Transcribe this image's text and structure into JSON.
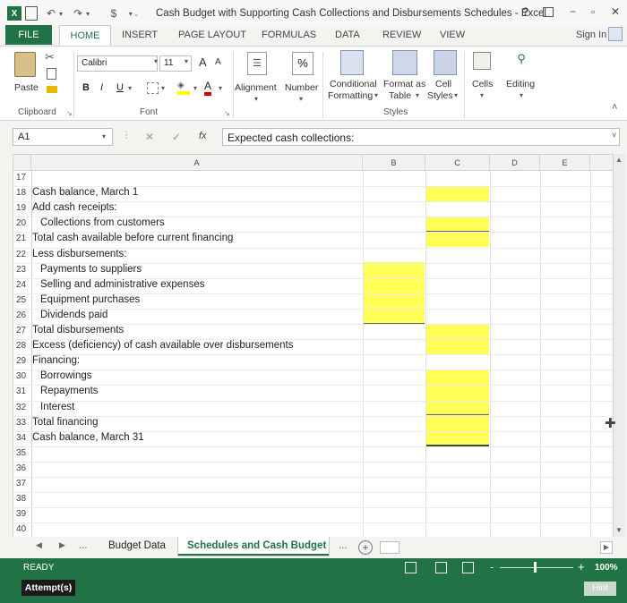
{
  "app": {
    "title": "Cash Budget with Supporting Cash Collections and Disbursements Schedules - Excel",
    "help": "?",
    "sign_in": "Sign In"
  },
  "ribbon_tabs": [
    "FILE",
    "HOME",
    "INSERT",
    "PAGE LAYOUT",
    "FORMULAS",
    "DATA",
    "REVIEW",
    "VIEW"
  ],
  "ribbon": {
    "paste": "Paste",
    "clipboard": "Clipboard",
    "font_name": "Calibri",
    "font_size": "11",
    "grow_font": "A",
    "shrink_font": "A",
    "bold": "B",
    "italic": "I",
    "underline": "U",
    "font_color": "A",
    "font_group": "Font",
    "alignment": "Alignment",
    "number": "Number",
    "percent": "%",
    "conditional": "Conditional",
    "formatting": "Formatting",
    "format_as": "Format as",
    "table": "Table",
    "cell": "Cell",
    "styles_btn": "Styles",
    "styles_group": "Styles",
    "cells": "Cells",
    "editing": "Editing"
  },
  "formula_bar": {
    "name_box": "A1",
    "cancel": "✕",
    "enter": "✓",
    "fx": "fx",
    "formula": "Expected cash collections:"
  },
  "grid": {
    "columns": [
      "A",
      "B",
      "C",
      "D",
      "E"
    ],
    "rows": [
      {
        "num": "17",
        "text": ""
      },
      {
        "num": "18",
        "text": "Cash balance, March 1"
      },
      {
        "num": "19",
        "text": "Add cash receipts:"
      },
      {
        "num": "20",
        "text": "Collections from customers"
      },
      {
        "num": "21",
        "text": "Total cash available before current financing"
      },
      {
        "num": "22",
        "text": "Less disbursements:"
      },
      {
        "num": "23",
        "text": "Payments to suppliers"
      },
      {
        "num": "24",
        "text": "Selling and administrative expenses"
      },
      {
        "num": "25",
        "text": "Equipment purchases"
      },
      {
        "num": "26",
        "text": "Dividends paid"
      },
      {
        "num": "27",
        "text": "Total disbursements"
      },
      {
        "num": "28",
        "text": "Excess (deficiency) of cash available over disbursements"
      },
      {
        "num": "29",
        "text": "Financing:"
      },
      {
        "num": "30",
        "text": "Borrowings"
      },
      {
        "num": "31",
        "text": "Repayments"
      },
      {
        "num": "32",
        "text": "Interest"
      },
      {
        "num": "33",
        "text": "Total financing"
      },
      {
        "num": "34",
        "text": "Cash balance, March 31"
      },
      {
        "num": "35",
        "text": ""
      },
      {
        "num": "36",
        "text": ""
      },
      {
        "num": "37",
        "text": ""
      },
      {
        "num": "38",
        "text": ""
      },
      {
        "num": "39",
        "text": ""
      },
      {
        "num": "40",
        "text": ""
      }
    ]
  },
  "sheet_tabs": {
    "more_left": "...",
    "tab1": "Budget Data",
    "tab2": "Schedules and Cash Budget",
    "more_right": "...",
    "add": "+"
  },
  "status": {
    "ready": "READY",
    "zoom_minus": "-",
    "zoom_plus": "+",
    "zoom": "100%",
    "attempts": "Attempt(s)",
    "hint": "Hint"
  },
  "colors": {
    "excel_green": "#217346",
    "input_yellow": "#ffff55"
  }
}
